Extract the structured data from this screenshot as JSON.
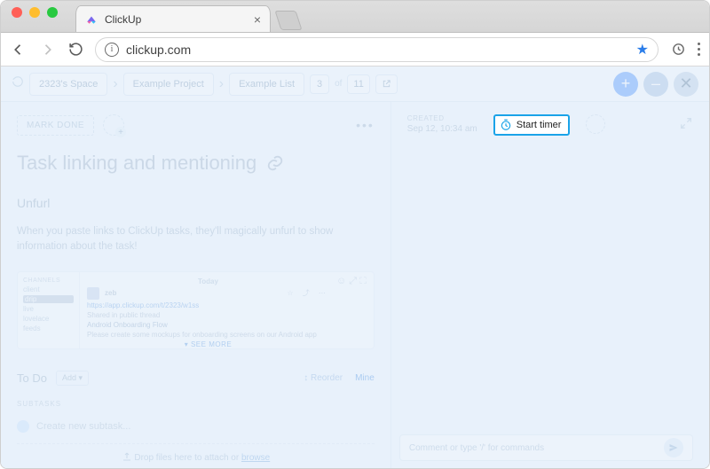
{
  "browser": {
    "tab_title": "ClickUp",
    "url": "clickup.com"
  },
  "breadcrumb": {
    "space": "2323's Space",
    "project": "Example Project",
    "list": "Example List",
    "index": "3",
    "of_label": "of",
    "total": "11"
  },
  "toolbar": {
    "mark_done": "MARK DONE",
    "more": "•••"
  },
  "task": {
    "title": "Task linking and mentioning",
    "section_unfurl": "Unfurl",
    "unfurl_desc": "When you paste links to ClickUp tasks, they'll magically unfurl to show information about the task!",
    "todo_label": "To Do",
    "add_label": "Add ▾",
    "reorder": "↕ Reorder",
    "mine": "Mine",
    "subtasks_label": "SUBTASKS",
    "new_subtask_placeholder": "Create new subtask...",
    "dropzone_prefix": "Drop files here to attach or ",
    "dropzone_link": "browse"
  },
  "embed": {
    "channels_label": "CHANNELS",
    "channels": [
      "client",
      "drip",
      "live",
      "lovelace",
      "feeds"
    ],
    "today": "Today",
    "user": "zeb",
    "link": "https://app.clickup.com/t/2323/w1ss",
    "line1": "Shared in public thread",
    "line2": "Android Onboarding Flow",
    "line3": "Please create some mockups for onboarding screens on our Android app",
    "see_more": "▾ SEE MORE"
  },
  "meta": {
    "created_label": "CREATED",
    "created_value": "Sep 12, 10:34 am",
    "start_timer": "Start timer"
  },
  "comment": {
    "placeholder": "Comment or type '/' for commands"
  }
}
